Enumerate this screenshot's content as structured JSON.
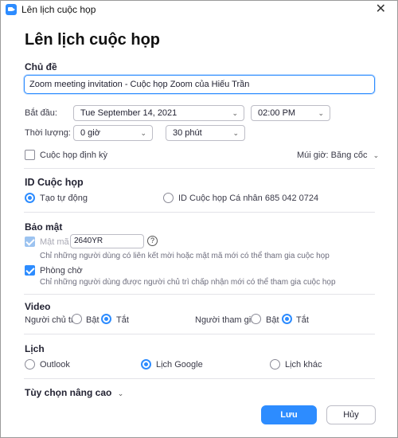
{
  "window": {
    "title": "Lên lịch cuộc họp"
  },
  "heading": "Lên lịch cuộc họp",
  "topic": {
    "label": "Chủ đề",
    "value": "Zoom meeting invitation - Cuộc họp Zoom của Hiếu Trần"
  },
  "schedule": {
    "start_label": "Bắt đầu:",
    "start_date": "Tue  September  14,  2021",
    "start_time": "02:00  PM",
    "duration_label": "Thời lượng:",
    "duration_hours": "0 giờ",
    "duration_minutes": "30 phút",
    "recurring_label": "Cuộc họp định kỳ",
    "recurring_checked": false,
    "timezone_label": "Múi giờ: Băng cốc"
  },
  "meeting_id": {
    "label": "ID Cuộc họp",
    "auto_label": "Tạo tự động",
    "personal_label": "ID Cuộc họp Cá nhân 685 042 0724",
    "selected": "auto"
  },
  "security": {
    "label": "Bảo mật",
    "passcode_label": "Mật mã",
    "passcode_value": "2640YR",
    "help_glyph": "?",
    "passcode_hint": "Chỉ những người dùng có liên kết mời hoặc mật mã mới có thể tham gia cuộc họp",
    "waiting_room_label": "Phòng chờ",
    "waiting_room_hint": "Chỉ những người dùng được người chủ trì chấp nhận mới có thể tham gia cuộc họp"
  },
  "video": {
    "label": "Video",
    "host_label": "Người chủ trì:",
    "participant_label": "Người tham gia:",
    "on_label": "Bật",
    "off_label": "Tắt"
  },
  "calendar": {
    "label": "Lịch",
    "options": [
      "Outlook",
      "Lịch Google",
      "Lịch khác"
    ],
    "selected": "Lịch Google"
  },
  "advanced": {
    "label": "Tùy chọn nâng cao"
  },
  "buttons": {
    "save": "Lưu",
    "cancel": "Hủy"
  },
  "colors": {
    "accent": "#2d8cff",
    "text": "#232333"
  },
  "icons": {
    "close": "✕",
    "chevron_down": "⌄"
  }
}
